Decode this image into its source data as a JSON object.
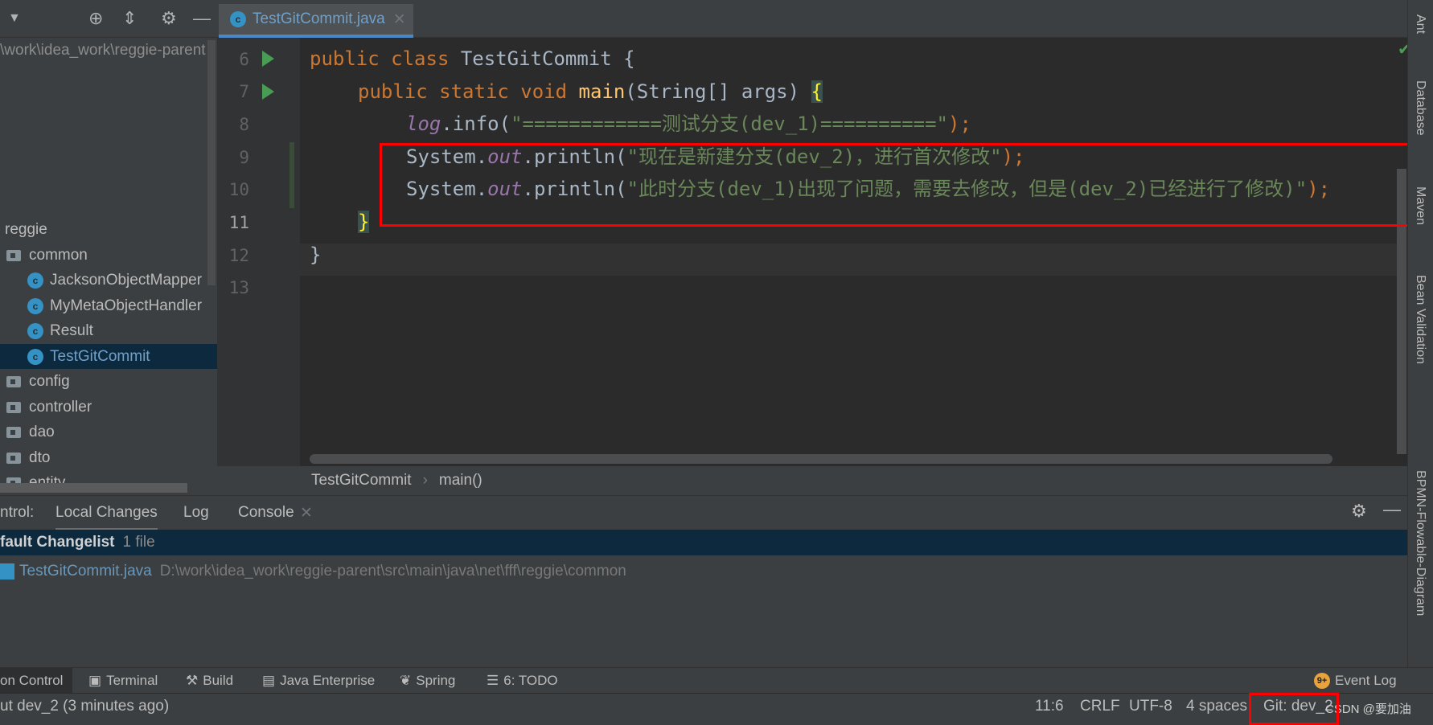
{
  "project": {
    "path": "\\work\\idea_work\\reggie-parent",
    "tree": [
      {
        "label": "reggie",
        "type": "module"
      },
      {
        "label": "common",
        "type": "folder"
      },
      {
        "label": "JacksonObjectMapper",
        "type": "class"
      },
      {
        "label": "MyMetaObjectHandler",
        "type": "class"
      },
      {
        "label": "Result",
        "type": "class"
      },
      {
        "label": "TestGitCommit",
        "type": "class",
        "selected": true
      },
      {
        "label": "config",
        "type": "folder"
      },
      {
        "label": "controller",
        "type": "folder"
      },
      {
        "label": "dao",
        "type": "folder"
      },
      {
        "label": "dto",
        "type": "folder"
      },
      {
        "label": "entity",
        "type": "folder"
      }
    ]
  },
  "editor": {
    "tab": "TestGitCommit.java",
    "line_numbers": [
      "6",
      "7",
      "8",
      "9",
      "10",
      "11",
      "12",
      "13"
    ],
    "code": {
      "l6a": "public class ",
      "l6b": "TestGitCommit {",
      "l7a": "public static void ",
      "l7b": "main",
      "l7c": "(String[] args) ",
      "l7d": "{",
      "l8a": "log",
      "l8b": ".info(",
      "l8c": "\"============测试分支(dev_1)==========\"",
      "l8d": ");",
      "l9a": "System.",
      "l9b": "out",
      "l9c": ".println(",
      "l9d": "\"现在是新建分支(dev_2)，进行首次修改\"",
      "l9e": ");",
      "l10a": "System.",
      "l10b": "out",
      "l10c": ".println(",
      "l10d": "\"此时分支(dev_1)出现了问题，需要去修改，但是(dev_2)已经进行了修改)\"",
      "l10e": ");",
      "l11": "}",
      "l12": "}"
    },
    "breadcrumb": [
      "TestGitCommit",
      "main()"
    ]
  },
  "right_tools": [
    "Ant",
    "Database",
    "Maven",
    "Bean Validation",
    "BPMN-Flowable-Diagram"
  ],
  "bottom": {
    "prefix": "ntrol:",
    "tabs": [
      "Local Changes",
      "Log",
      "Console"
    ],
    "changelist": "fault Changelist",
    "changelist_count": "1 file",
    "file": "TestGitCommit.java",
    "file_path": "D:\\work\\idea_work\\reggie-parent\\src\\main\\java\\net\\fff\\reggie\\common"
  },
  "toolwindows": [
    "on Control",
    "Terminal",
    "Build",
    "Java Enterprise",
    "Spring",
    "6: TODO"
  ],
  "event_log": {
    "badge": "9+",
    "label": "Event Log"
  },
  "status": {
    "message": "ut dev_2 (3 minutes ago)",
    "position": "11:6",
    "line_sep": "CRLF",
    "encoding": "UTF-8",
    "indent": "4 spaces",
    "git": "Git: dev_2",
    "watermark": "CSDN @要加油"
  },
  "colors": {
    "keyword": "#cc7832",
    "string": "#6a8759",
    "selection": "#0d293e",
    "highlight_box": "#ff0000"
  }
}
